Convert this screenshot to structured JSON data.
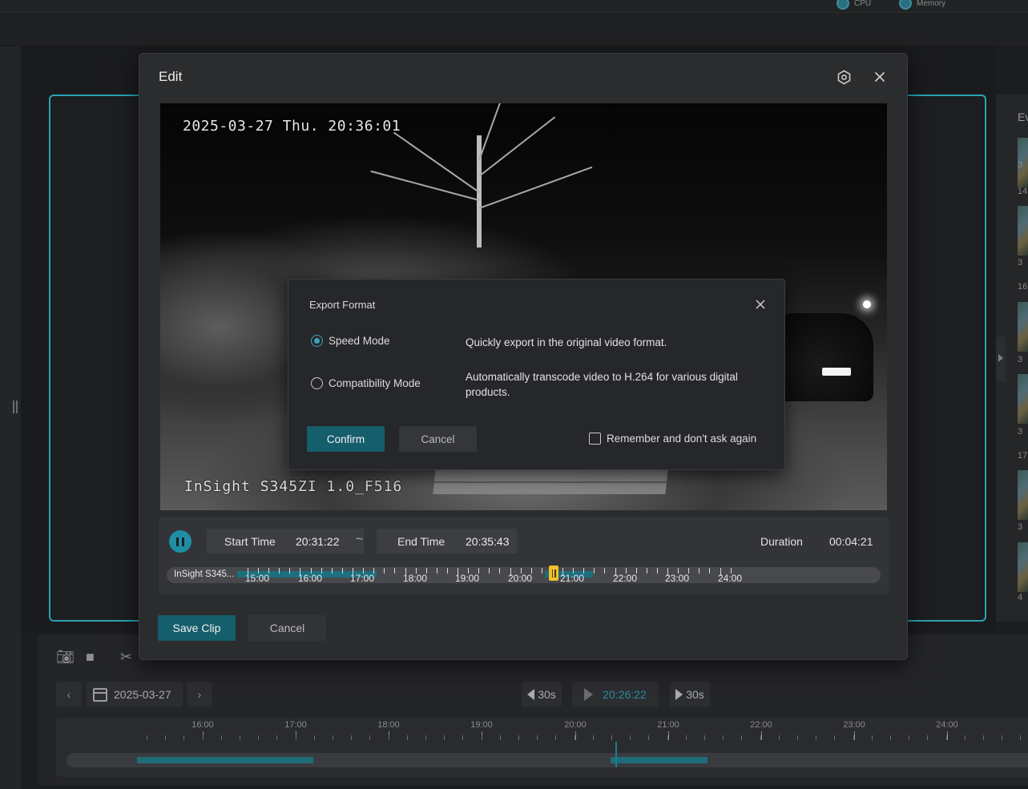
{
  "background": {
    "topbar": {
      "cpu_label": "CPU",
      "memory_label": "Memory"
    },
    "events_label": "Ev",
    "event_thumbs": [
      {
        "label": "3"
      },
      {
        "label": "14"
      },
      {
        "label": "3"
      },
      {
        "label": "16"
      },
      {
        "label": "3"
      },
      {
        "label": "3"
      },
      {
        "label": "17"
      },
      {
        "label": "3"
      },
      {
        "label": "4"
      }
    ],
    "date": "2025-03-27",
    "back_30s": "30s",
    "forward_30s": "30s",
    "playback_time": "20:26:22",
    "timeline_labels": [
      "16:00",
      "17:00",
      "18:00",
      "19:00",
      "20:00",
      "21:00",
      "22:00",
      "23:00",
      "24:00"
    ]
  },
  "edit": {
    "title": "Edit",
    "video": {
      "osd_datetime": "2025-03-27 Thu. 20:36:01",
      "osd_camera": "InSight S345ZI 1.0_F516"
    },
    "start_time_label": "Start Time",
    "start_time": "20:31:22",
    "separator": "~",
    "end_time_label": "End Time",
    "end_time": "20:35:43",
    "duration_label": "Duration",
    "duration": "00:04:21",
    "timeline": {
      "camera": "InSight S345...",
      "labels": [
        "15:00",
        "16:00",
        "17:00",
        "18:00",
        "19:00",
        "20:00",
        "21:00",
        "22:00",
        "23:00",
        "24:00"
      ]
    },
    "save_label": "Save Clip",
    "cancel_label": "Cancel"
  },
  "export": {
    "title": "Export Format",
    "options": [
      {
        "label": "Speed Mode",
        "description": "Quickly export in the original video format.",
        "selected": true
      },
      {
        "label": "Compatibility Mode",
        "description": "Automatically transcode video to H.264 for various digital products.",
        "selected": false
      }
    ],
    "confirm_label": "Confirm",
    "cancel_label": "Cancel",
    "remember_label": "Remember and don't ask again",
    "remember_checked": false
  },
  "colors": {
    "accent": "#1f8ea3",
    "button_primary": "#155e6c",
    "handle": "#f2c02c",
    "frame": "#2aa3b3"
  }
}
